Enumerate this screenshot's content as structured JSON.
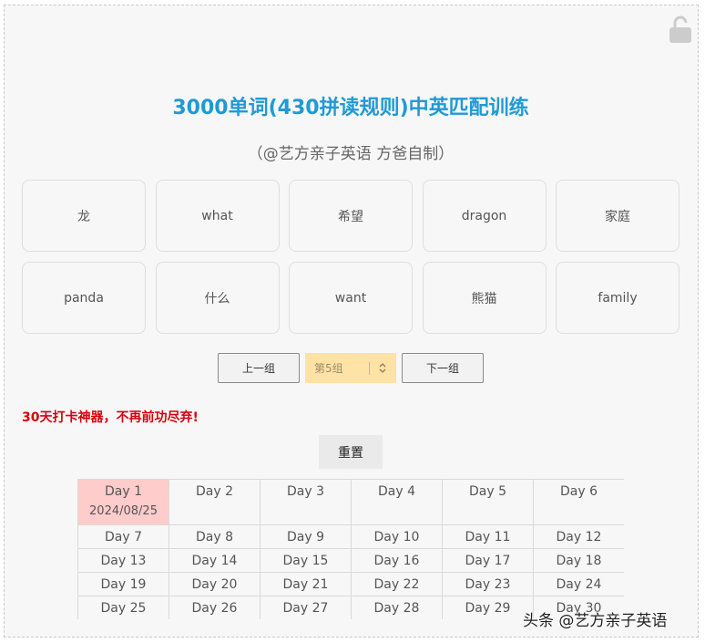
{
  "title": "3000单词(430拼读规则)中英匹配训练",
  "subtitle": "（@艺方亲子英语 方爸自制）",
  "cards": [
    "龙",
    "what",
    "希望",
    "dragon",
    "家庭",
    "panda",
    "什么",
    "want",
    "熊猫",
    "family"
  ],
  "nav": {
    "prev_label": "上一组",
    "group_select_value": "第5组",
    "next_label": "下一组"
  },
  "slogan": "30天打卡神器，不再前功尽弃!",
  "reset_label": "重置",
  "days": [
    {
      "label": "Day 1",
      "date": "2024/08/25"
    },
    {
      "label": "Day 2"
    },
    {
      "label": "Day 3"
    },
    {
      "label": "Day 4"
    },
    {
      "label": "Day 5"
    },
    {
      "label": "Day 6"
    },
    {
      "label": "Day 7"
    },
    {
      "label": "Day 8"
    },
    {
      "label": "Day 9"
    },
    {
      "label": "Day 10"
    },
    {
      "label": "Day 11"
    },
    {
      "label": "Day 12"
    },
    {
      "label": "Day 13"
    },
    {
      "label": "Day 14"
    },
    {
      "label": "Day 15"
    },
    {
      "label": "Day 16"
    },
    {
      "label": "Day 17"
    },
    {
      "label": "Day 18"
    },
    {
      "label": "Day 19"
    },
    {
      "label": "Day 20"
    },
    {
      "label": "Day 21"
    },
    {
      "label": "Day 22"
    },
    {
      "label": "Day 23"
    },
    {
      "label": "Day 24"
    },
    {
      "label": "Day 25"
    },
    {
      "label": "Day 26"
    },
    {
      "label": "Day 27"
    },
    {
      "label": "Day 28"
    },
    {
      "label": "Day 29"
    },
    {
      "label": "Day 30"
    }
  ],
  "watermark": "头条 @艺方亲子英语",
  "colors": {
    "title": "#1f9ad6",
    "slogan": "#d8000c",
    "active_day": "#ffcccc",
    "select_bg": "#ffe3a6"
  },
  "icons": {
    "lock": "unlock-icon",
    "select_arrows": "updown-chevron-icon"
  }
}
